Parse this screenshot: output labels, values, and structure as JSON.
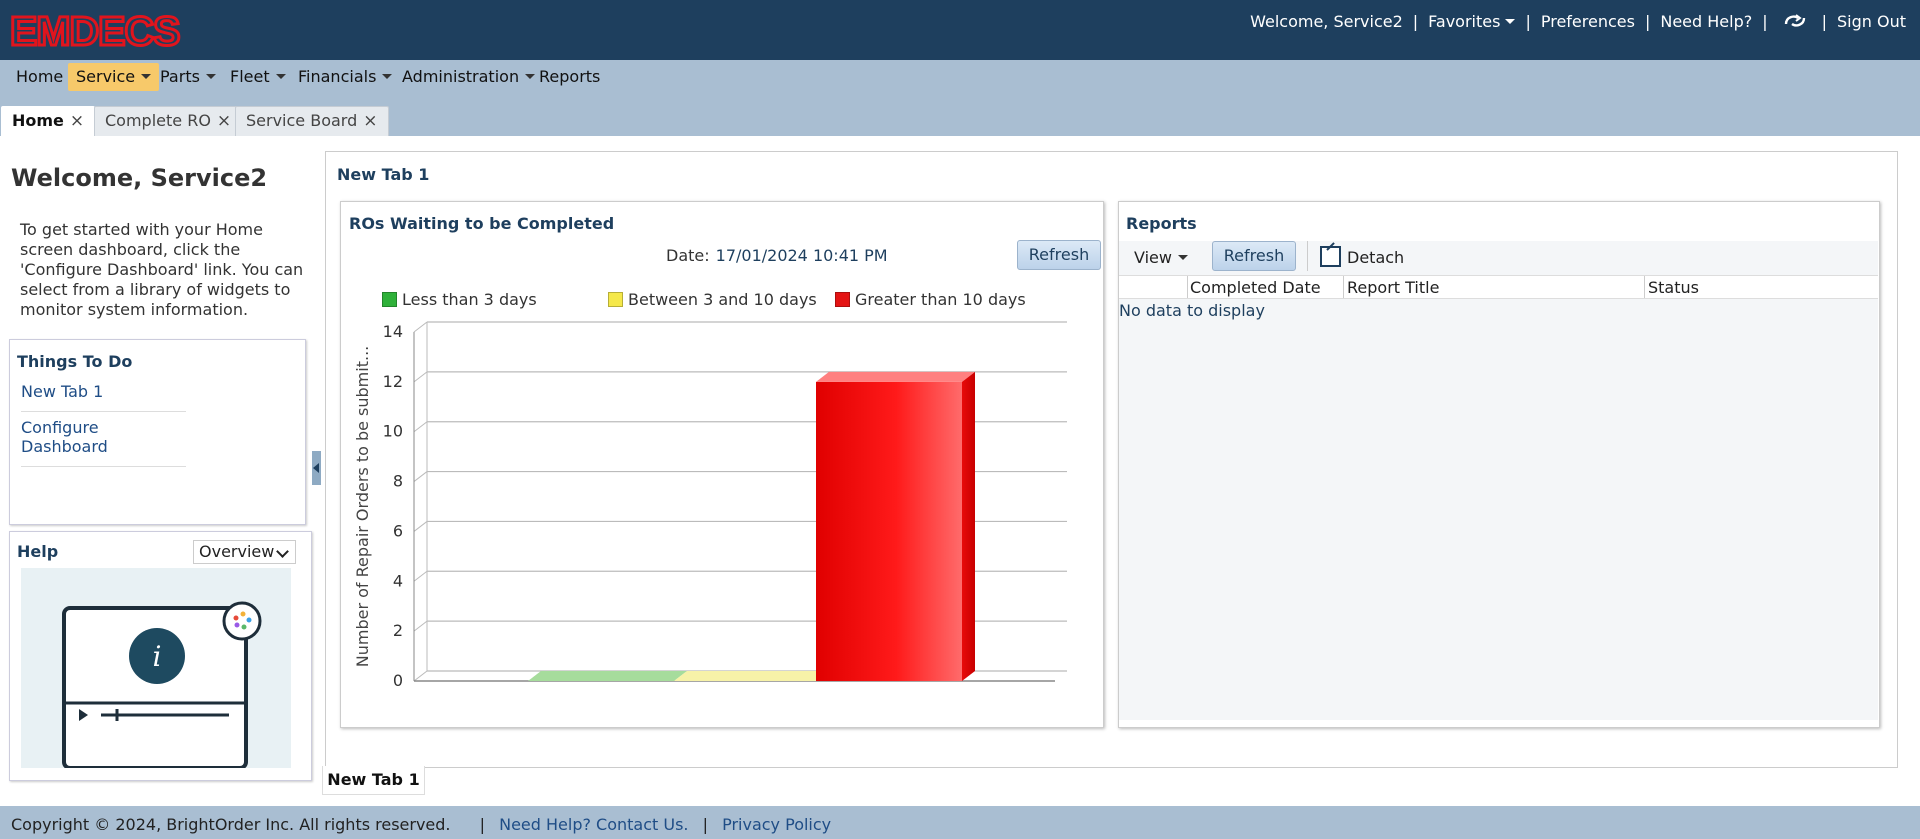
{
  "app": {
    "logo": "EMDECS"
  },
  "header": {
    "welcome": "Welcome, Service2",
    "favorites": "Favorites",
    "preferences": "Preferences",
    "need_help": "Need Help?",
    "sign_out": "Sign Out",
    "sep": "|",
    "sync_icon": "sync-icon"
  },
  "menu": [
    {
      "label": "Home",
      "active": false
    },
    {
      "label": "Service",
      "active": true
    },
    {
      "label": "Parts",
      "active": false
    },
    {
      "label": "Fleet",
      "active": false
    },
    {
      "label": "Financials",
      "active": false
    },
    {
      "label": "Administration",
      "active": false
    },
    {
      "label": "Reports",
      "active": false
    }
  ],
  "tabs": [
    {
      "label": "Home",
      "active": true
    },
    {
      "label": "Complete RO",
      "active": false
    },
    {
      "label": "Service Board",
      "active": false
    }
  ],
  "tab_close_glyph": "×",
  "sidebar": {
    "welcome": "Welcome, Service2",
    "intro": "To get started with your Home screen dashboard, click the 'Configure Dashboard' link. You can select from a library of widgets to monitor system information.",
    "todo_title": "Things To Do",
    "todo_links": [
      "New Tab 1",
      "Configure Dashboard"
    ],
    "help_title": "Help",
    "help_select": "Overview"
  },
  "dashboard": {
    "title": "New Tab 1",
    "bottom_tab": "New Tab 1"
  },
  "ro_widget": {
    "title": "ROs Waiting to be Completed",
    "date_label": "Date:",
    "date_value": "17/01/2024 10:41 PM",
    "refresh": "Refresh"
  },
  "chart_data": {
    "type": "bar",
    "title": "",
    "ylabel": "Number of Repair Orders to be submit...",
    "xlabel": "",
    "ylim": [
      0,
      14
    ],
    "yticks": [
      "0",
      "2",
      "4",
      "6",
      "8",
      "10",
      "12",
      "14"
    ],
    "grid": true,
    "legend": "top",
    "categories": [
      "Less than 3 days",
      "Between 3 and 10 days",
      "Greater than 10 days"
    ],
    "values": [
      0,
      0,
      12
    ],
    "colors": [
      "#2fb13a",
      "#f5e84a",
      "#e41414"
    ]
  },
  "reports": {
    "title": "Reports",
    "view": "View",
    "refresh": "Refresh",
    "detach": "Detach",
    "columns": [
      "Completed Date",
      "Report Title",
      "Status"
    ],
    "empty": "No data to display"
  },
  "footer": {
    "copyright": "Copyright © 2024, BrightOrder Inc. All rights reserved.",
    "sep": "|",
    "contact": "Need Help? Contact Us.",
    "privacy": "Privacy Policy"
  }
}
